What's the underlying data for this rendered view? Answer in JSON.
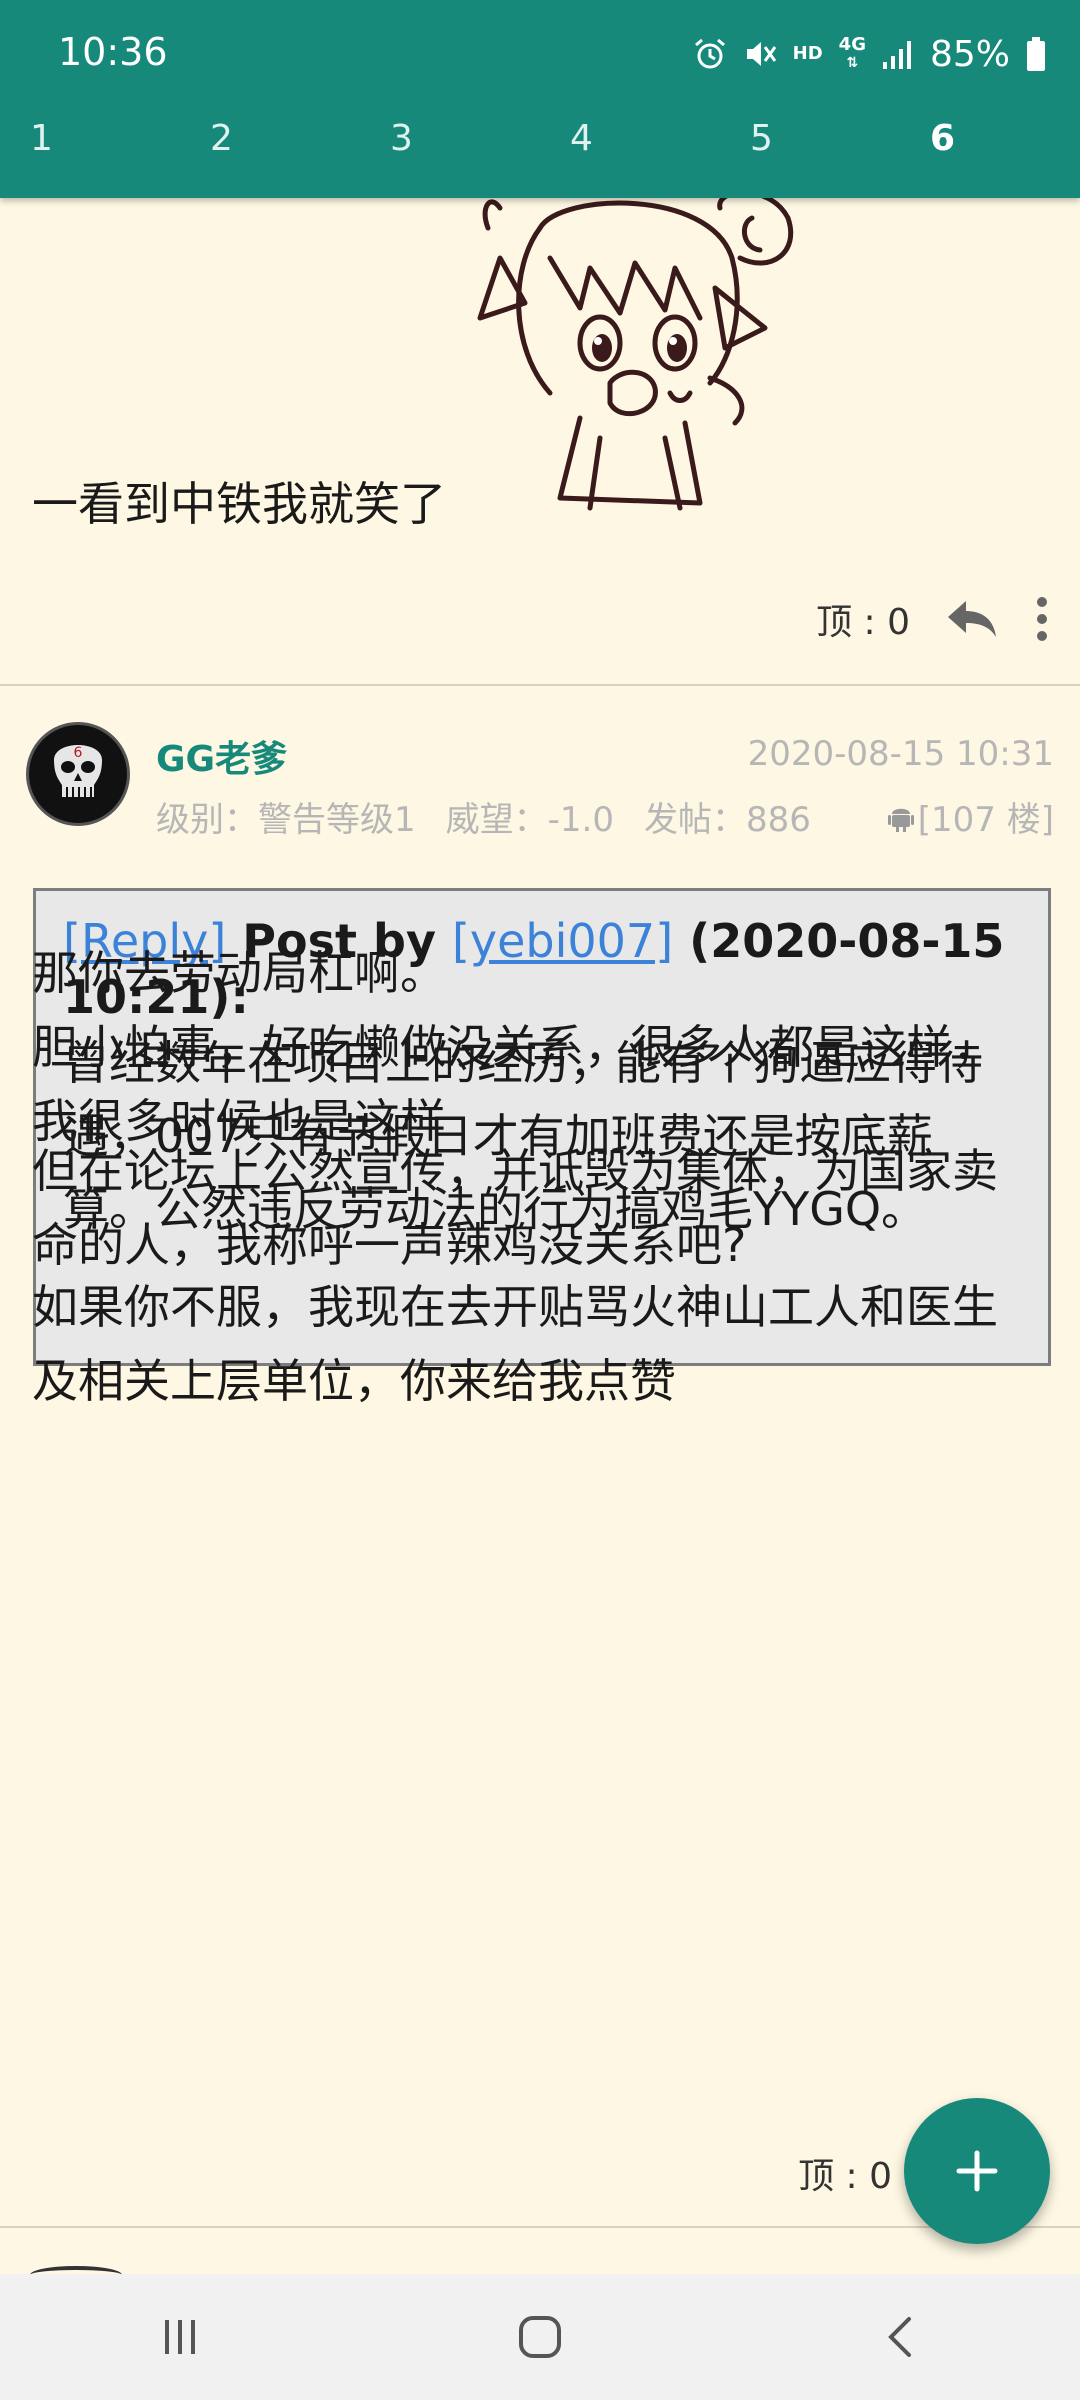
{
  "status": {
    "time": "10:36",
    "network_hd": "HD",
    "network_type": "4G",
    "battery": "85%"
  },
  "pages": [
    "1",
    "2",
    "3",
    "4",
    "5",
    "6"
  ],
  "active_page": "6",
  "post_prev": {
    "text": "一看到中铁我就笑了",
    "top_label": "顶 : 0"
  },
  "post": {
    "username": "GG老爹",
    "avatar_number": "6",
    "date": "2020-08-15 10:31",
    "level": "级别：警告等级1",
    "prestige": "威望：-1.0",
    "posts": "发帖：886",
    "floor": "[107 楼]",
    "quote": {
      "reply_link": "[Reply]",
      "post_by": " Post by ",
      "author_link": "[yebi007]",
      "time": " (2020-08-15 10:21):",
      "body": "曾经数年在项目上的经历，能有个狗逼应得待遇，007只有节假日才有加班费还是按底薪算。公然违反劳动法的行为搞鸡毛YYGQ。"
    },
    "para1": "那你去劳动局杠啊。\n胆小怕事，好吃懒做没关系，很多人都是这样，我很多时候也是这样",
    "para2": "但在论坛上公然宣传，并诋毁为集体，为国家卖命的人，我称呼一声辣鸡没关系吧?",
    "para3": "如果你不服，我现在去开贴骂火神山工人和医生及相关上层单位，你来给我点赞",
    "top_label": "顶 : 0"
  },
  "colors": {
    "primary": "#16897a",
    "background": "#fdf7e3",
    "link": "#3b82d8"
  },
  "icons": [
    "alarm-icon",
    "mute-icon",
    "signal-icon",
    "battery-icon",
    "reply-icon",
    "more-vert-icon",
    "android-icon",
    "plus-icon",
    "recents-icon",
    "home-icon",
    "back-icon"
  ]
}
